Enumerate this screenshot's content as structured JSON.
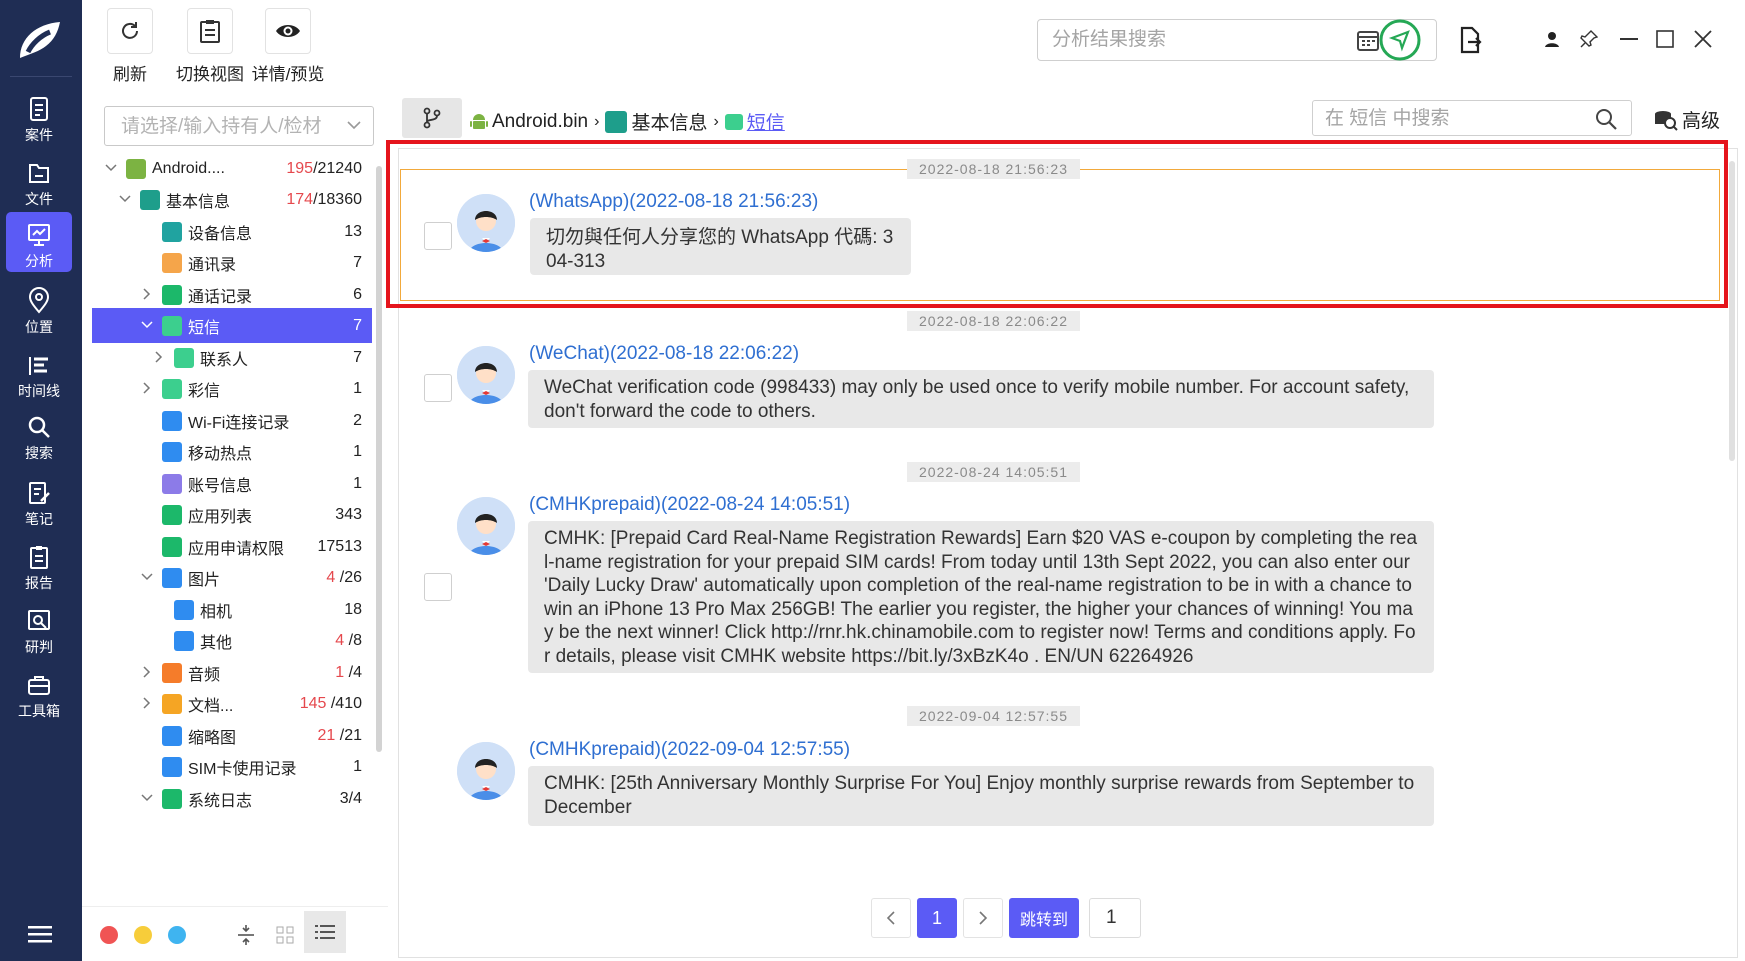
{
  "toolbar": {
    "refresh": "刷新",
    "switch_view": "切换视图",
    "details_preview": "详情/预览",
    "search_placeholder": "分析结果搜索"
  },
  "nav": [
    {
      "label": "案件",
      "icon": "case-icon"
    },
    {
      "label": "文件",
      "icon": "file-icon"
    },
    {
      "label": "分析",
      "icon": "analysis-icon"
    },
    {
      "label": "位置",
      "icon": "location-icon"
    },
    {
      "label": "时间线",
      "icon": "timeline-icon"
    },
    {
      "label": "搜索",
      "icon": "search-icon"
    },
    {
      "label": "笔记",
      "icon": "notes-icon"
    },
    {
      "label": "报告",
      "icon": "report-icon"
    },
    {
      "label": "研判",
      "icon": "judge-icon"
    },
    {
      "label": "工具箱",
      "icon": "toolbox-icon"
    }
  ],
  "owner_placeholder": "请选择/输入持有人/检材",
  "tree": [
    {
      "label": "Android....",
      "hit": "195",
      "total": "/21240",
      "icon": "android-icon",
      "color": "#7cb342"
    },
    {
      "label": "基本信息",
      "hit": "174",
      "total": "/18360",
      "icon": "basic-info-icon",
      "color": "#1e9e8b"
    },
    {
      "label": "设备信息",
      "hit": "",
      "total": "13",
      "icon": "device-info-icon",
      "color": "#20a3a0"
    },
    {
      "label": "通讯录",
      "hit": "",
      "total": "7",
      "icon": "contacts-icon",
      "color": "#f5a54a"
    },
    {
      "label": "通话记录",
      "hit": "",
      "total": "6",
      "icon": "call-log-icon",
      "color": "#1cb86a"
    },
    {
      "label": "短信",
      "hit": "",
      "total": "7",
      "icon": "sms-icon",
      "color": "#3ccf8e"
    },
    {
      "label": "联系人",
      "hit": "",
      "total": "7",
      "icon": "sms-contact-icon",
      "color": "#3ccf8e"
    },
    {
      "label": "彩信",
      "hit": "",
      "total": "1",
      "icon": "mms-icon",
      "color": "#3ccf8e"
    },
    {
      "label": "Wi-Fi连接记录",
      "hit": "",
      "total": "2",
      "icon": "wifi-icon",
      "color": "#2f8cf0"
    },
    {
      "label": "移动热点",
      "hit": "",
      "total": "1",
      "icon": "hotspot-icon",
      "color": "#2f8cf0"
    },
    {
      "label": "账号信息",
      "hit": "",
      "total": "1",
      "icon": "account-icon",
      "color": "#8c7be8"
    },
    {
      "label": "应用列表",
      "hit": "",
      "total": "343",
      "icon": "app-list-icon",
      "color": "#1cb86a"
    },
    {
      "label": "应用申请权限",
      "hit": "",
      "total": "17513",
      "icon": "app-permission-icon",
      "color": "#1cb86a"
    },
    {
      "label": "图片",
      "hit": "4",
      "total": " /26",
      "icon": "image-icon",
      "color": "#2f8cf0"
    },
    {
      "label": "相机",
      "hit": "",
      "total": "18",
      "icon": "camera-image-icon",
      "color": "#2f8cf0"
    },
    {
      "label": "其他",
      "hit": "4",
      "total": " /8",
      "icon": "other-image-icon",
      "color": "#2f8cf0"
    },
    {
      "label": "音频",
      "hit": "1",
      "total": " /4",
      "icon": "audio-icon",
      "color": "#f57c2a"
    },
    {
      "label": "文档...",
      "hit": "145",
      "total": " /410",
      "icon": "document-icon",
      "color": "#f5a524"
    },
    {
      "label": "缩略图",
      "hit": "21",
      "total": " /21",
      "icon": "thumbnail-icon",
      "color": "#2f8cf0"
    },
    {
      "label": "SIM卡使用记录",
      "hit": "",
      "total": "1",
      "icon": "sim-icon",
      "color": "#2f8cf0"
    },
    {
      "label": "系统日志",
      "hit": "",
      "total": "3/4",
      "icon": "system-log-icon",
      "color": "#1cb86a"
    }
  ],
  "breadcrumb": {
    "root": "Android.bin",
    "level2": "基本信息",
    "current": "短信"
  },
  "content_search_placeholder": "在 短信 中搜索",
  "advanced": "高级",
  "messages": [
    {
      "timestamp": "2022-08-18 21:56:23",
      "sender": "(WhatsApp)(2022-08-18 21:56:23)",
      "body": "切勿與任何人分享您的 WhatsApp 代碼: 304-313"
    },
    {
      "timestamp": "2022-08-18 22:06:22",
      "sender": "(WeChat)(2022-08-18 22:06:22)",
      "body": "WeChat verification code (998433) may only be used once to verify mobile number. For account safety, don't forward the code to others."
    },
    {
      "timestamp": "2022-08-24 14:05:51",
      "sender": "(CMHKprepaid)(2022-08-24 14:05:51)",
      "body": "CMHK: [Prepaid Card Real-Name Registration Rewards] Earn $20 VAS e-coupon by completing the real-name registration for your prepaid SIM cards! From today until 13th Sept 2022, you can also enter our 'Daily Lucky Draw'   automatically upon completion of the real-name registration to be in with a chance to win an iPhone 13 Pro Max 256GB! The earlier you register, the higher your chances of winning! You may be the next winner! Click http://rnr.hk.chinamobile.com to register now! Terms and conditions apply. For details, please visit CMHK website https://bit.ly/3xBzK4o . EN/UN 62264926"
    },
    {
      "timestamp": "2022-09-04 12:57:55",
      "sender": "(CMHKprepaid)(2022-09-04 12:57:55)",
      "body": "CMHK: [25th Anniversary Monthly Surprise For You] Enjoy monthly surprise rewards from September to December"
    }
  ],
  "pager": {
    "current": "1",
    "jump_label": "跳转到",
    "jump_value": "1"
  },
  "colors": {
    "accent": "#5b5bf5",
    "nav_bg": "#1f2d54",
    "highlight_red": "#e5141c",
    "highlight_orange": "#f2a93b",
    "sender_link": "#2f6fd1"
  }
}
